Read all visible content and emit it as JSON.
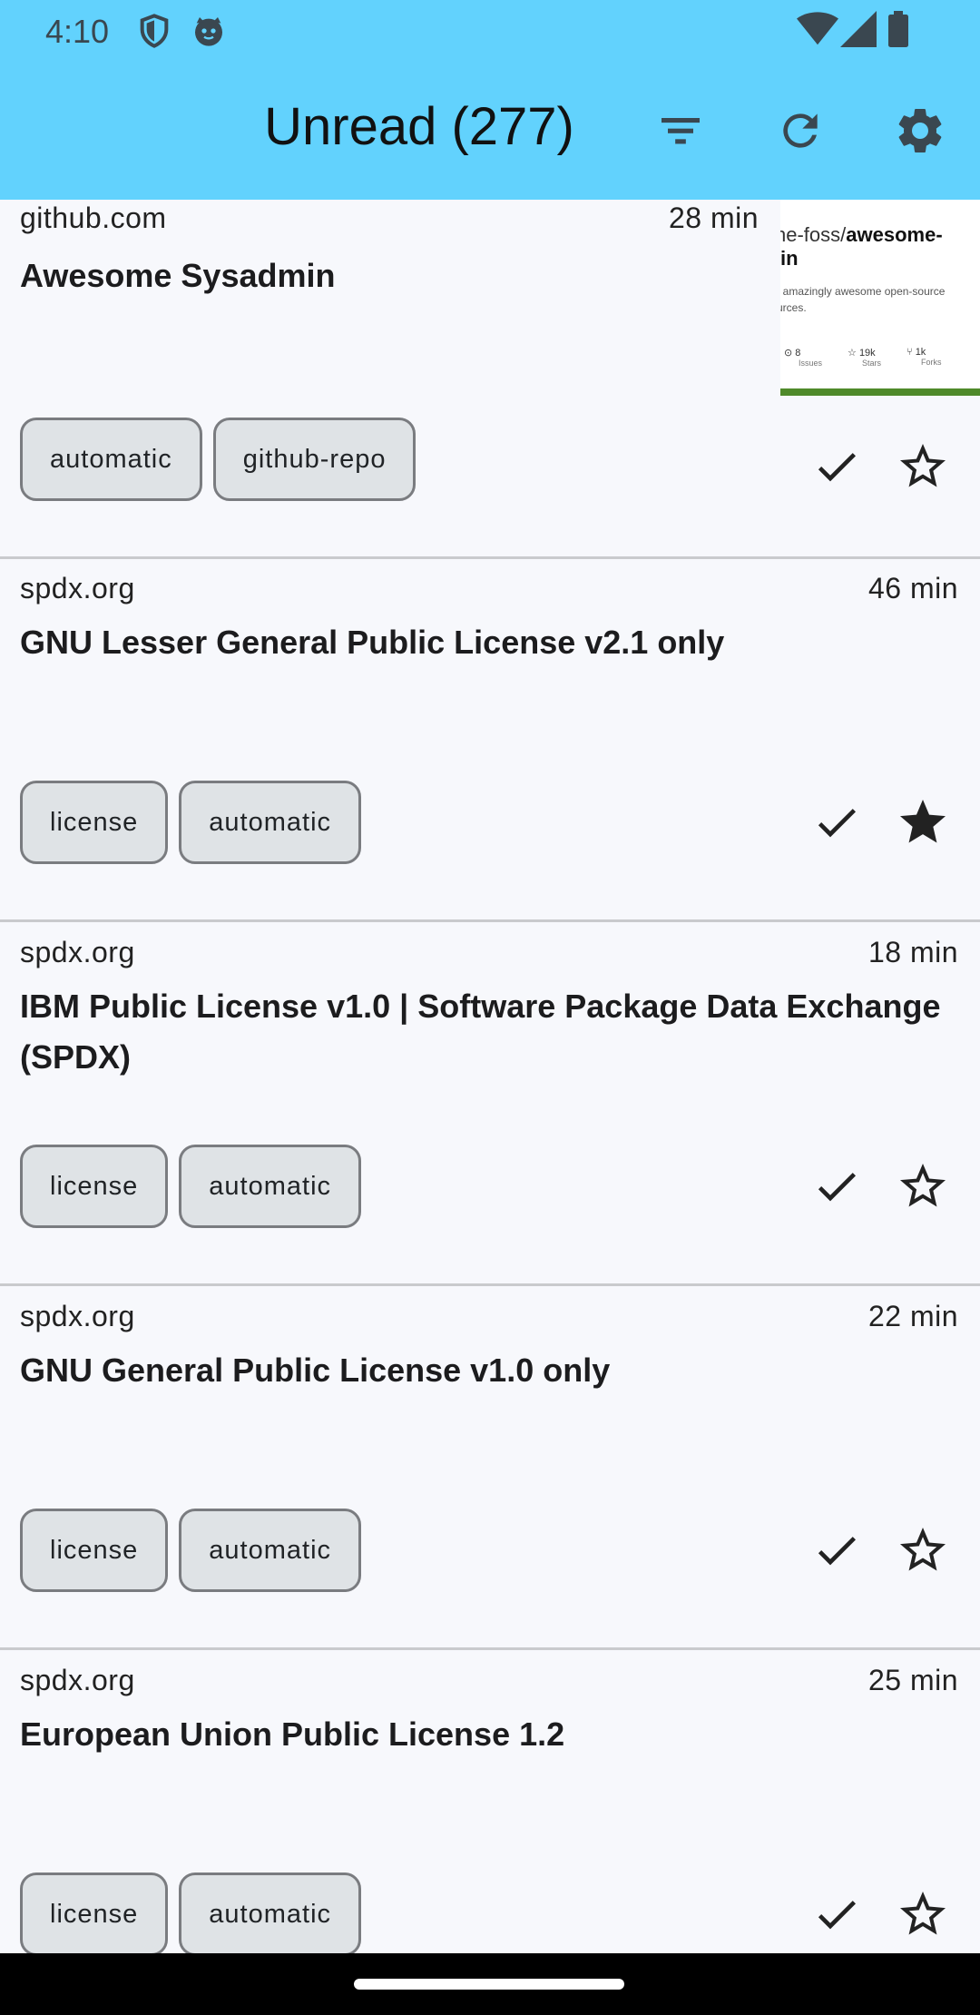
{
  "status": {
    "time": "4:10",
    "icons": [
      "shield-icon",
      "cat-face-icon",
      "wifi-icon",
      "signal-icon",
      "battery-icon"
    ]
  },
  "appbar": {
    "title": "Unread (277)",
    "actions": [
      "filter-icon",
      "refresh-icon",
      "settings-icon"
    ]
  },
  "articles": [
    {
      "source": "github.com",
      "time": "28 min",
      "title": "Awesome Sysadmin",
      "tags": [
        "automatic",
        "github-repo"
      ],
      "starred": false,
      "thumbnail": {
        "line1_prefix": "ne-foss/",
        "line1_bold": "awesome-",
        "line2": "in",
        "line3": "f amazingly awesome open-source",
        "line4": "urces.",
        "stats": [
          {
            "value": "8",
            "label": "Issues"
          },
          {
            "value": "19k",
            "label": "Stars"
          },
          {
            "value": "1k",
            "label": "Forks"
          }
        ]
      }
    },
    {
      "source": "spdx.org",
      "time": "46 min",
      "title": "GNU Lesser General Public License v2.1 only",
      "tags": [
        "license",
        "automatic"
      ],
      "starred": true
    },
    {
      "source": "spdx.org",
      "time": "18 min",
      "title": "IBM Public License v1.0 | Software Package Data Exchange (SPDX)",
      "tags": [
        "license",
        "automatic"
      ],
      "starred": false
    },
    {
      "source": "spdx.org",
      "time": "22 min",
      "title": "GNU General Public License v1.0 only",
      "tags": [
        "license",
        "automatic"
      ],
      "starred": false
    },
    {
      "source": "spdx.org",
      "time": "25 min",
      "title": "European Union Public License 1.2",
      "tags": [
        "license",
        "automatic"
      ],
      "starred": false
    }
  ],
  "colors": {
    "appbar": "#62d2fd",
    "background": "#f7f8fc",
    "tag_fill": "#dfe3e6",
    "tag_border": "#7a7c80",
    "divider": "#c9cacd"
  }
}
